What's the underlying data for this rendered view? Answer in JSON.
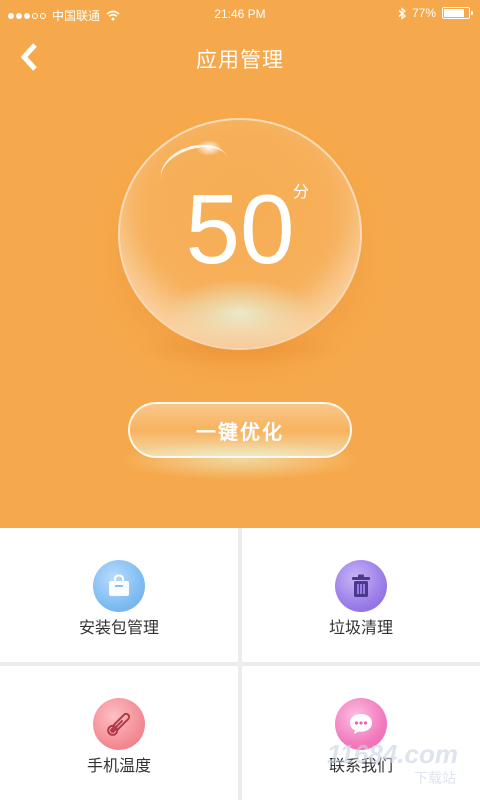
{
  "status_bar": {
    "carrier": "中国联通",
    "time": "21:46 PM",
    "battery_text": "77%",
    "battery_level": 0.77
  },
  "header": {
    "title": "应用管理"
  },
  "score": {
    "value": "50",
    "unit": "分"
  },
  "optimize_button": {
    "label": "一键优化"
  },
  "grid": {
    "items": [
      {
        "label": "安装包管理",
        "icon": "shopping-bag-icon"
      },
      {
        "label": "垃圾清理",
        "icon": "trash-icon"
      },
      {
        "label": "手机温度",
        "icon": "thermometer-icon"
      },
      {
        "label": "联系我们",
        "icon": "chat-bubble-icon"
      }
    ]
  },
  "watermark": {
    "text": "11684.com",
    "sub": "下载站"
  },
  "colors": {
    "accent": "#f6a94c"
  }
}
